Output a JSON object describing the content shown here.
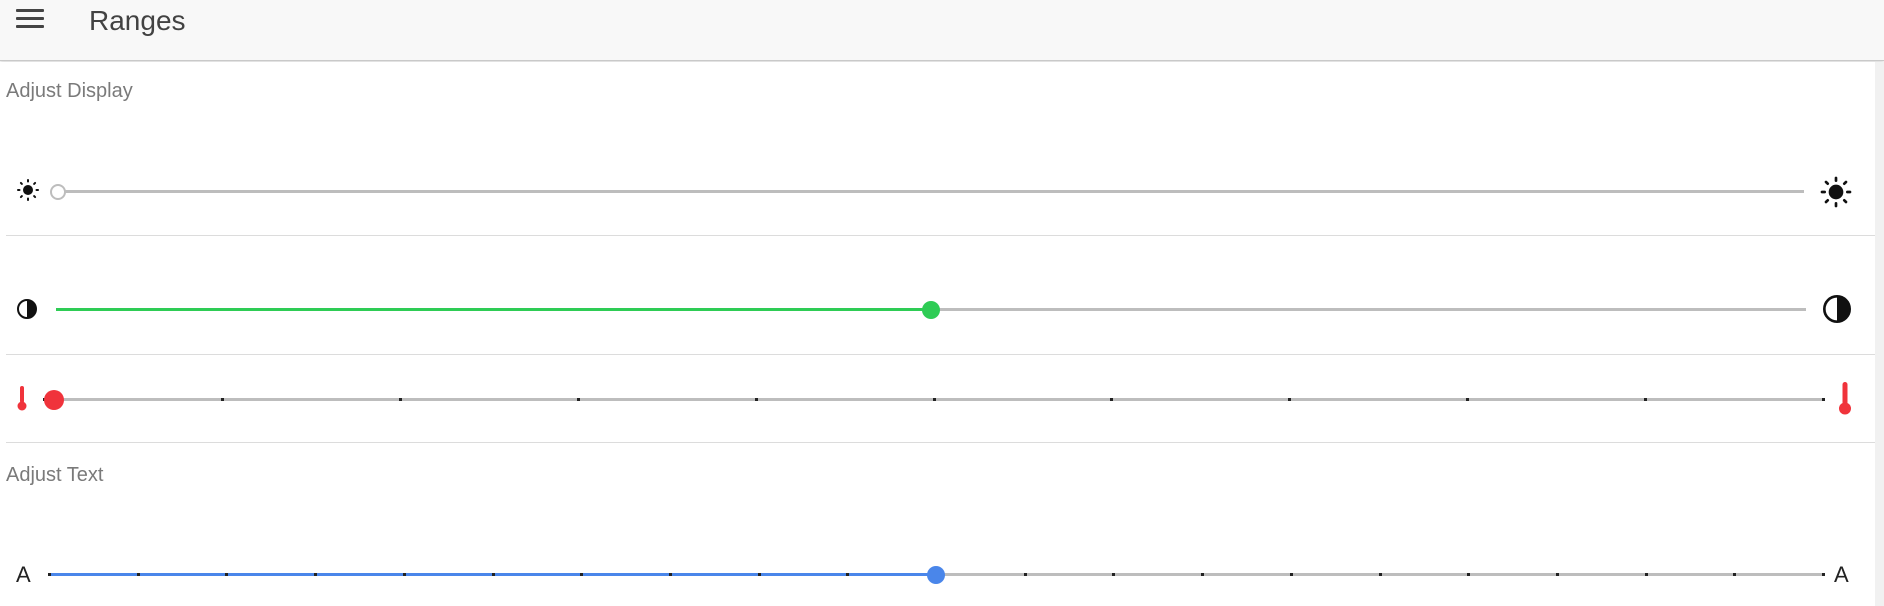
{
  "toolbar": {
    "title": "Ranges",
    "menu_icon": "menu-icon"
  },
  "sections": {
    "display": {
      "header": "Adjust Display",
      "brightness": {
        "value": 0,
        "min_icon": "brightness-low-icon",
        "max_icon": "brightness-high-icon"
      },
      "contrast": {
        "value": 0.5,
        "color": "#2ecc55",
        "min_icon": "contrast-icon",
        "max_icon": "contrast-icon"
      },
      "warmth": {
        "value": 0,
        "steps": 10,
        "color": "#f0333b",
        "min_icon": "thermometer-icon",
        "max_icon": "thermometer-icon"
      }
    },
    "text": {
      "header": "Adjust Text",
      "size": {
        "value": 0.5,
        "steps": 20,
        "color": "#4a86ea",
        "min_label": "A",
        "max_label": "A"
      }
    }
  },
  "colors": {
    "track": "#bdbdbd",
    "brightness_knob_border": "#bdbdbd"
  }
}
